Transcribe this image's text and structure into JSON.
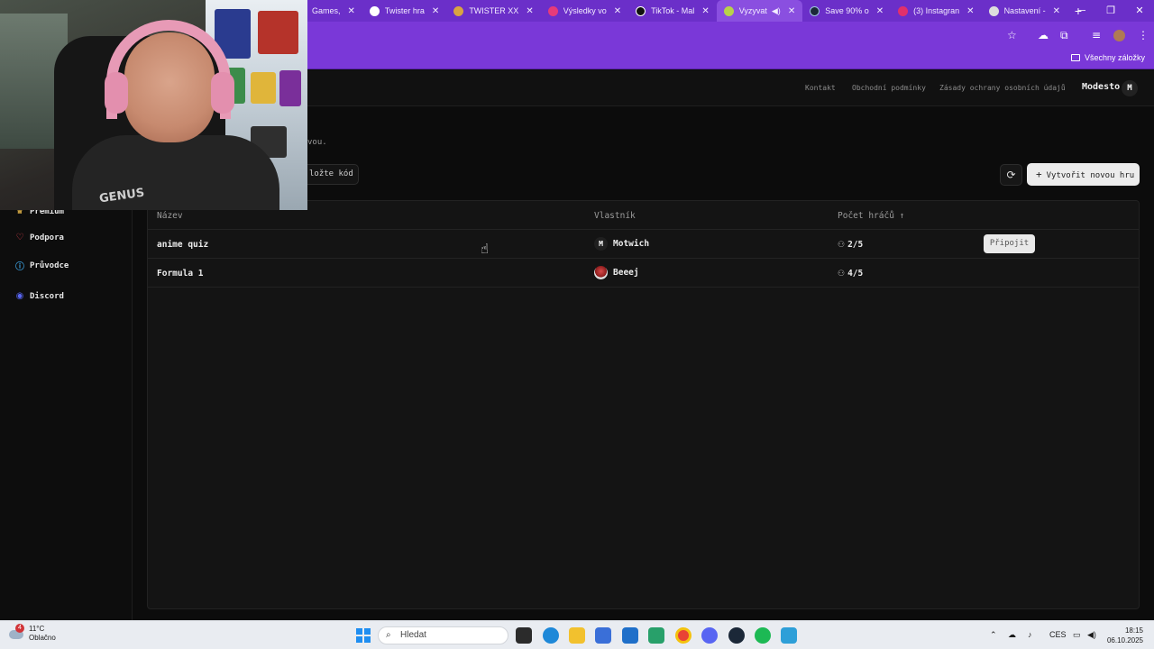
{
  "browser": {
    "tabs": [
      {
        "title": "Games,",
        "favicon_color": "#2e2e2e"
      },
      {
        "title": "Twister hra",
        "favicon_color": "#ffffff"
      },
      {
        "title": "TWISTER XX",
        "favicon_color": "#d9a441"
      },
      {
        "title": "Výsledky vo",
        "favicon_color": "#e53b7a"
      },
      {
        "title": "TikTok - Mal",
        "favicon_color": "#111111"
      },
      {
        "title": "Vyzyvat",
        "favicon_color": "#b8d24a",
        "active": true
      },
      {
        "title": "Save 90% o",
        "favicon_color": "#1b2838"
      },
      {
        "title": "(3) Instagran",
        "favicon_color": "#e1306c"
      },
      {
        "title": "Nastavení -",
        "favicon_color": "#dddddd"
      }
    ],
    "new_tab_label": "+",
    "bookmarks_all_label": "Všechny záložky"
  },
  "site_header": {
    "links": [
      "Kontakt",
      "Obchodní podmínky",
      "Zásady ochrany osobních údajů"
    ],
    "user_name": "Modesto",
    "user_initial": "M"
  },
  "main": {
    "subtitle_fragment": "vou.",
    "code_button_label": "ložte kód",
    "create_button_label": "Vytvořit novou hru"
  },
  "sidebar": {
    "items": [
      {
        "label": "Premium",
        "icon": "crown-icon"
      },
      {
        "label": "Podpora",
        "icon": "heart-icon"
      },
      {
        "label": "Průvodce",
        "icon": "help-icon"
      },
      {
        "label": "Discord",
        "icon": "discord-icon"
      }
    ]
  },
  "games_table": {
    "columns": [
      "Název",
      "Vlastník",
      "Počet hráčů ↑"
    ],
    "rows": [
      {
        "name": "anime quiz",
        "owner": "Motwich",
        "owner_initial": "M",
        "players": "2/5",
        "action": "Připojit"
      },
      {
        "name": "Formula 1",
        "owner": "Beeej",
        "owner_initial": "",
        "players": "4/5",
        "action": ""
      }
    ]
  },
  "webcam": {
    "shirt_text": "GENUS"
  },
  "taskbar": {
    "weather_badge": "4",
    "temperature": "11°C",
    "condition": "Oblačno",
    "search_placeholder": "Hledat",
    "language": "CES",
    "time": "18:15",
    "date": "06.10.2025"
  },
  "colors": {
    "accent": "#7a38d8",
    "tab_strip": "#6b2fc9",
    "page_bg": "#0c0c0c",
    "panel_bg": "#141414",
    "heart": "#e0414f",
    "help": "#3b9bd8",
    "discord": "#5865f2"
  }
}
